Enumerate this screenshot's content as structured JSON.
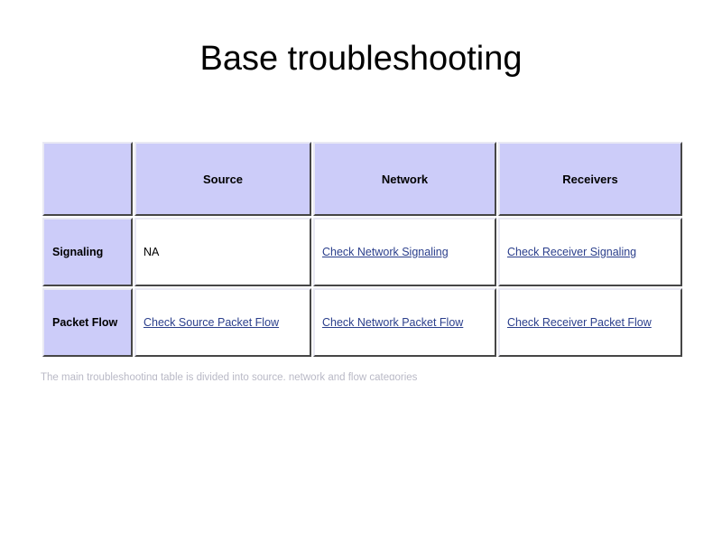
{
  "slide": {
    "title": "Base troubleshooting"
  },
  "table": {
    "columns": [
      {
        "key": "rowlabel",
        "label": ""
      },
      {
        "key": "source",
        "label": "Source"
      },
      {
        "key": "network",
        "label": "Network"
      },
      {
        "key": "receivers",
        "label": "Receivers"
      }
    ],
    "rows": [
      {
        "label": "Signaling",
        "cells": [
          {
            "type": "text",
            "value": "NA"
          },
          {
            "type": "link",
            "value": "Check Network Signaling"
          },
          {
            "type": "link",
            "value": "Check Receiver Signaling"
          }
        ]
      },
      {
        "label": "Packet Flow",
        "cells": [
          {
            "type": "link",
            "value": "Check Source Packet Flow"
          },
          {
            "type": "link",
            "value": "Check Network Packet Flow"
          },
          {
            "type": "link",
            "value": "Check Receiver Packet Flow"
          }
        ]
      }
    ]
  },
  "caption": {
    "text": "The main troubleshooting table is divided into source, network and flow categories"
  },
  "colors": {
    "header_fill": "#ccccf9",
    "row_label_fill": "#ccccf9",
    "link": "#2b3f8c",
    "cell_fill": "#ffffff",
    "border_light": "#e9e9f4",
    "border_dark": "#9a9a9a",
    "text": "#000000"
  }
}
